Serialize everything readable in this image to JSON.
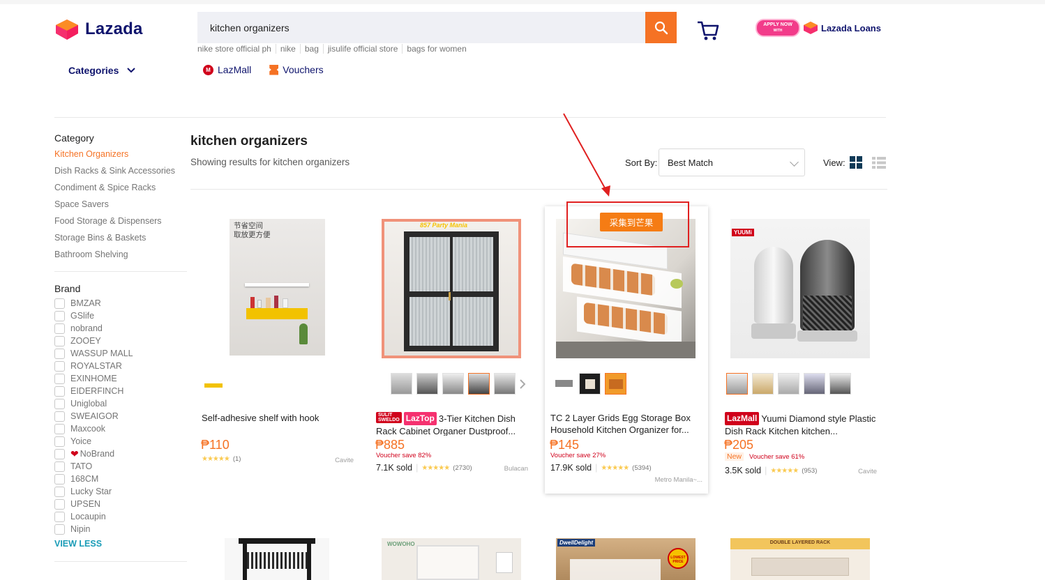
{
  "header": {
    "logo_text": "Lazada",
    "search_value": "kitchen organizers",
    "suggestions": [
      "nike store official ph",
      "nike",
      "bag",
      "jisulife official store",
      "bags for women"
    ],
    "apply_now": "APPLY NOW",
    "apply_with": "WITH",
    "loans_text": "Lazada Loans",
    "categories_label": "Categories",
    "lazmall_label": "LazMall",
    "vouchers_label": "Vouchers"
  },
  "sidebar": {
    "category_heading": "Category",
    "categories": [
      "Kitchen Organizers",
      "Dish Racks & Sink Accessories",
      "Condiment & Spice Racks",
      "Space Savers",
      "Food Storage & Dispensers",
      "Storage Bins & Baskets",
      "Bathroom Shelving"
    ],
    "brand_heading": "Brand",
    "brands": [
      "BMZAR",
      "GSlife",
      "nobrand",
      "ZOOEY",
      "WASSUP MALL",
      "ROYALSTAR",
      "EXINHOME",
      "EIDERFINCH",
      "Uniglobal",
      "SWEAIGOR",
      "Maxcook",
      "Yoice",
      "NoBrand",
      "TATO",
      "168CM",
      "Lucky Star",
      "UPSEN",
      "Locaupin",
      "Nipin"
    ],
    "view_less": "VIEW LESS"
  },
  "results": {
    "title": "kitchen organizers",
    "subtitle": "Showing results for kitchen organizers",
    "sort_label": "Sort By:",
    "sort_value": "Best Match",
    "view_label": "View:"
  },
  "products": [
    {
      "title": "Self-adhesive shelf with hook",
      "price": "₱110",
      "rating_count": "(1)",
      "location": "Cavite",
      "img_text_1": "节省空间",
      "img_text_2": "取放更方便"
    },
    {
      "badge1_top": "SULIT",
      "badge1_bot": "SWELDO",
      "badge2": "LazTop",
      "title": "3-Tier Kitchen Dish Rack Cabinet Organer Dustproof...",
      "price": "₱885",
      "voucher": "Voucher save 82%",
      "sold": "7.1K sold",
      "rating_count": "(2730)",
      "location": "Bulacan",
      "img_banner": "857 Party Mania"
    },
    {
      "title": "TC 2 Layer Grids Egg Storage Box Household Kitchen Organizer for...",
      "price": "₱145",
      "voucher": "Voucher save 27%",
      "sold": "17.9K sold",
      "rating_count": "(5394)",
      "location": "Metro Manila~..."
    },
    {
      "badge": "LazMall",
      "title": "Yuumi Diamond style Plastic Dish Rack Kitchen kitchen...",
      "price": "₱205",
      "new_label": "New",
      "voucher": "Voucher save 61%",
      "sold": "3.5K sold",
      "rating_count": "(953)",
      "location": "Cavite",
      "img_logo": "YUUMi"
    }
  ],
  "row2": {
    "brand3": "DwellDelight",
    "brand2": "WOWOHO",
    "banner4": "DOUBLE LAYERED RACK",
    "seal3": "LOWEST PRICE"
  },
  "overlay": {
    "collect_label": "采集到芒果"
  },
  "colors": {
    "accent": "#f57224",
    "navy": "#0f146d",
    "annotation_red": "#e02020"
  }
}
